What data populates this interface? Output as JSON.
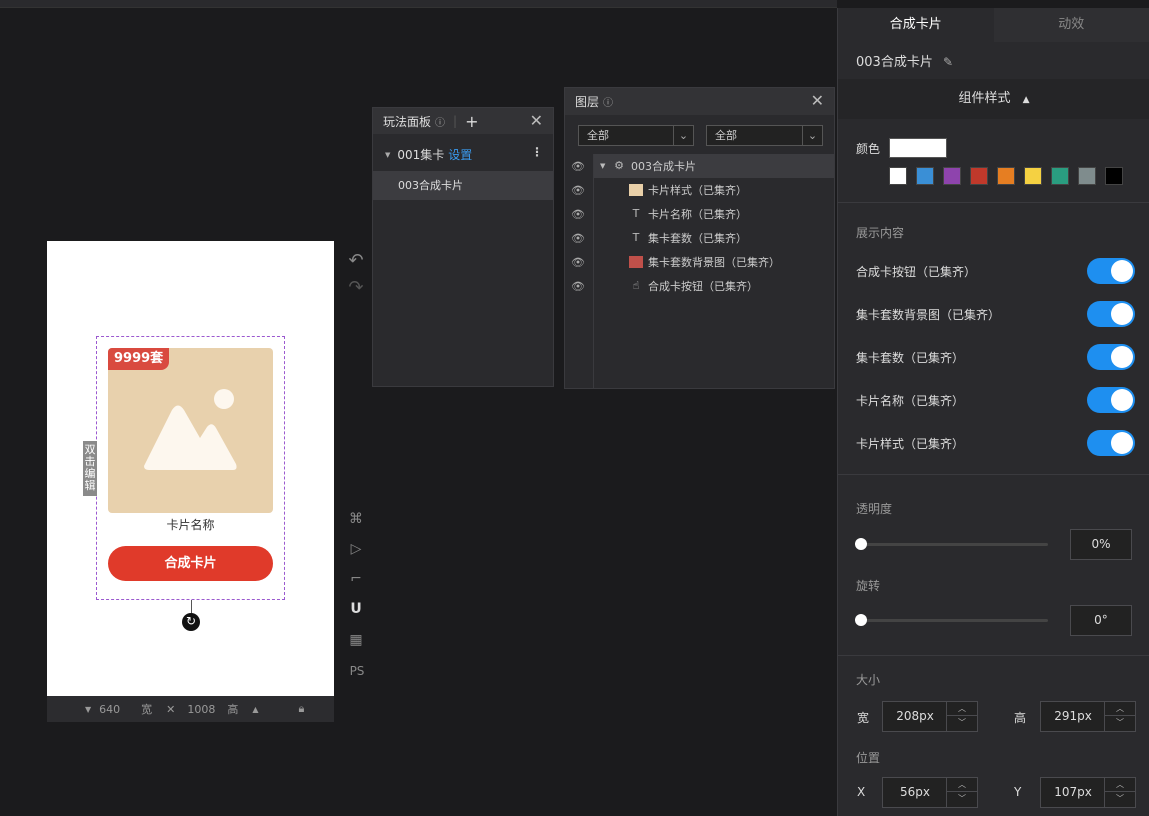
{
  "canvas": {
    "badge": "9999套",
    "card_name": "卡片名称",
    "card_button": "合成卡片",
    "double_click_edit": "双击编辑",
    "width_value": "640",
    "width_label": "宽",
    "height_value": "1008",
    "height_label": "高",
    "multiply": "✕"
  },
  "play_panel": {
    "title": "玩法面板",
    "group": "001集卡",
    "group_link": "设置",
    "item": "003合成卡片"
  },
  "layer_panel": {
    "title": "图层",
    "filter1": "全部",
    "filter2": "全部",
    "root": "003合成卡片",
    "layers": [
      {
        "icon": "image-icon",
        "label": "卡片样式（已集齐）"
      },
      {
        "icon": "text-icon",
        "label": "卡片名称（已集齐）"
      },
      {
        "icon": "text-icon",
        "label": "集卡套数（已集齐）"
      },
      {
        "icon": "image-icon",
        "label": "集卡套数背景图（已集齐）"
      },
      {
        "icon": "hand-icon",
        "label": "合成卡按钮（已集齐）"
      }
    ]
  },
  "right_panel": {
    "tabs": [
      "合成卡片",
      "动效"
    ],
    "component_name": "003合成卡片",
    "style_header": "组件样式",
    "color_label": "颜色",
    "current_color": "#ffffff",
    "swatches": [
      "#ffffff",
      "#3a8fd6",
      "#8e44ad",
      "#c0392b",
      "#e67e22",
      "#f5d142",
      "#2a9d80",
      "#7f8c8d",
      "#000000"
    ],
    "display_title": "展示内容",
    "toggles": [
      {
        "label": "合成卡按钮（已集齐）",
        "on": true
      },
      {
        "label": "集卡套数背景图（已集齐）",
        "on": true
      },
      {
        "label": "集卡套数（已集齐）",
        "on": true
      },
      {
        "label": "卡片名称（已集齐）",
        "on": true
      },
      {
        "label": "卡片样式（已集齐）",
        "on": true
      }
    ],
    "opacity_label": "透明度",
    "opacity_value": "0%",
    "rotation_label": "旋转",
    "rotation_value": "0°",
    "size_label": "大小",
    "width_label": "宽",
    "width_value": "208px",
    "height_label": "高",
    "height_value": "291px",
    "position_label": "位置",
    "x_label": "X",
    "x_value": "56px",
    "y_label": "Y",
    "y_value": "107px"
  }
}
